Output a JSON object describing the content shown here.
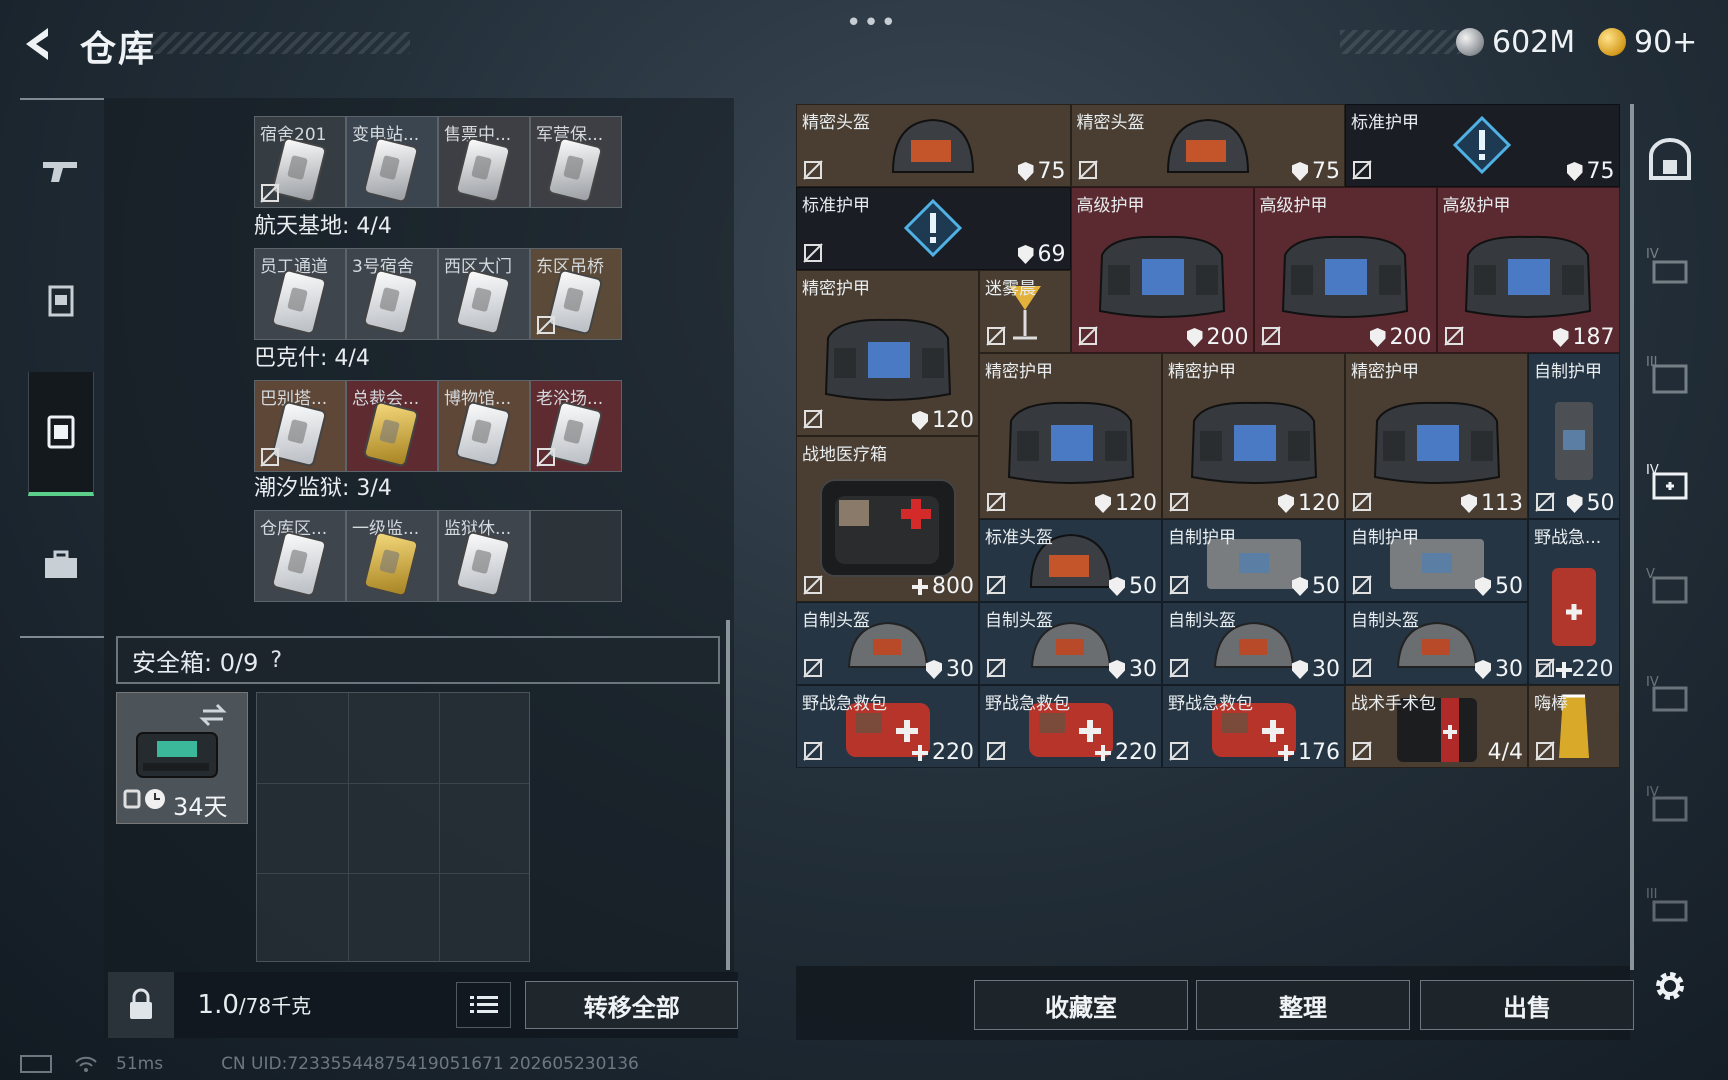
{
  "header": {
    "title": "仓库",
    "more": "•••",
    "currency": [
      {
        "icon": "silver-coin",
        "value": "602M"
      },
      {
        "icon": "gold-coin",
        "value": "90+"
      }
    ]
  },
  "left": {
    "groups": [
      {
        "title": "",
        "cards": [
          {
            "label": "宿舍201",
            "style": "dark",
            "no_insure": true
          },
          {
            "label": "变电站...",
            "style": "dark"
          },
          {
            "label": "售票中...",
            "style": "dark"
          },
          {
            "label": "军营保...",
            "style": "dark"
          }
        ]
      },
      {
        "title": "航天基地: 4/4",
        "cards": [
          {
            "label": "员工通道",
            "style": "white"
          },
          {
            "label": "3号宿舍",
            "style": "white"
          },
          {
            "label": "西区大门",
            "style": "white"
          },
          {
            "label": "东区吊桥",
            "style": "white",
            "no_insure": true
          }
        ]
      },
      {
        "title": "巴克什: 4/4",
        "cards": [
          {
            "label": "巴别塔...",
            "style": "white",
            "no_insure": true
          },
          {
            "label": "总裁会...",
            "style": "gold"
          },
          {
            "label": "博物馆...",
            "style": "white"
          },
          {
            "label": "老浴场...",
            "style": "white",
            "no_insure": true
          }
        ]
      },
      {
        "title": "潮汐监狱: 3/4",
        "cards": [
          {
            "label": "仓库区...",
            "style": "white"
          },
          {
            "label": "一级监...",
            "style": "gold"
          },
          {
            "label": "监狱休...",
            "style": "white"
          }
        ]
      }
    ],
    "safe_title": "安全箱: 0/9",
    "safe_help": "?",
    "safebox_days": "34天",
    "weight": "1.0",
    "weight_max": "/78千克",
    "transfer_all": "转移全部"
  },
  "stash": {
    "items": [
      {
        "name": "精密头盔",
        "val": "75",
        "kind": "shield",
        "bg": "brown",
        "art": "helmet"
      },
      {
        "name": "精密头盔",
        "val": "75",
        "kind": "shield",
        "bg": "brown",
        "art": "helmet"
      },
      {
        "name": "标准护甲",
        "val": "75",
        "kind": "shield",
        "bg": "dark",
        "art": "alert"
      },
      {
        "name": "标准护甲",
        "val": "69",
        "kind": "shield",
        "bg": "dark",
        "art": "alert"
      },
      {
        "name": "高级护甲",
        "val": "200",
        "kind": "shield",
        "bg": "red",
        "art": "vest"
      },
      {
        "name": "高级护甲",
        "val": "200",
        "kind": "shield",
        "bg": "red",
        "art": "vest"
      },
      {
        "name": "高级护甲",
        "val": "187",
        "kind": "shield",
        "bg": "red",
        "art": "vest"
      },
      {
        "name": "精密护甲",
        "val": "120",
        "kind": "shield",
        "bg": "brown",
        "art": "vest"
      },
      {
        "name": "迷雾晨",
        "val": "",
        "kind": "none",
        "bg": "brown",
        "art": "glass"
      },
      {
        "name": "精密护甲",
        "val": "120",
        "kind": "shield",
        "bg": "brown",
        "art": "vest"
      },
      {
        "name": "精密护甲",
        "val": "120",
        "kind": "shield",
        "bg": "brown",
        "art": "vest"
      },
      {
        "name": "精密护甲",
        "val": "113",
        "kind": "shield",
        "bg": "brown",
        "art": "vest"
      },
      {
        "name": "自制护甲",
        "val": "50",
        "kind": "shield",
        "bg": "blue",
        "art": "pack"
      },
      {
        "name": "战地医疗箱",
        "val": "800",
        "kind": "plus",
        "bg": "brown",
        "art": "medbox"
      },
      {
        "name": "标准头盔",
        "val": "50",
        "kind": "shield",
        "bg": "blue",
        "art": "helmet"
      },
      {
        "name": "自制护甲",
        "val": "50",
        "kind": "shield",
        "bg": "blue",
        "art": "plate"
      },
      {
        "name": "自制护甲",
        "val": "50",
        "kind": "shield",
        "bg": "blue",
        "art": "plate"
      },
      {
        "name": "野战急...",
        "val": "",
        "kind": "none",
        "bg": "blue",
        "art": "medsmall"
      },
      {
        "name": "自制头盔",
        "val": "30",
        "kind": "shield",
        "bg": "blue",
        "art": "helmet2"
      },
      {
        "name": "自制头盔",
        "val": "30",
        "kind": "shield",
        "bg": "blue",
        "art": "helmet2"
      },
      {
        "name": "自制头盔",
        "val": "30",
        "kind": "shield",
        "bg": "blue",
        "art": "helmet2"
      },
      {
        "name": "自制头盔",
        "val": "30",
        "kind": "shield",
        "bg": "blue",
        "art": "helmet2"
      },
      {
        "name": "",
        "val": "220",
        "kind": "plus",
        "bg": "blue",
        "art": "none"
      },
      {
        "name": "野战急救包",
        "val": "220",
        "kind": "plus",
        "bg": "blue",
        "art": "medkit"
      },
      {
        "name": "野战急救包",
        "val": "220",
        "kind": "plus",
        "bg": "blue",
        "art": "medkit"
      },
      {
        "name": "野战急救包",
        "val": "176",
        "kind": "plus",
        "bg": "blue",
        "art": "medkit"
      },
      {
        "name": "战术手术包",
        "val": "4/4",
        "kind": "text",
        "bg": "brown",
        "art": "surgery"
      },
      {
        "name": "嗨棒",
        "val": "",
        "kind": "none",
        "bg": "brown",
        "art": "drink"
      }
    ]
  },
  "buttons": {
    "collection": "收藏室",
    "sort": "整理",
    "sell": "出售"
  },
  "status": {
    "ping": "51ms",
    "uid": "CN UID:7233554487541905167​1 202605230136"
  },
  "colors": {
    "accent_green": "#5ccf8a"
  }
}
